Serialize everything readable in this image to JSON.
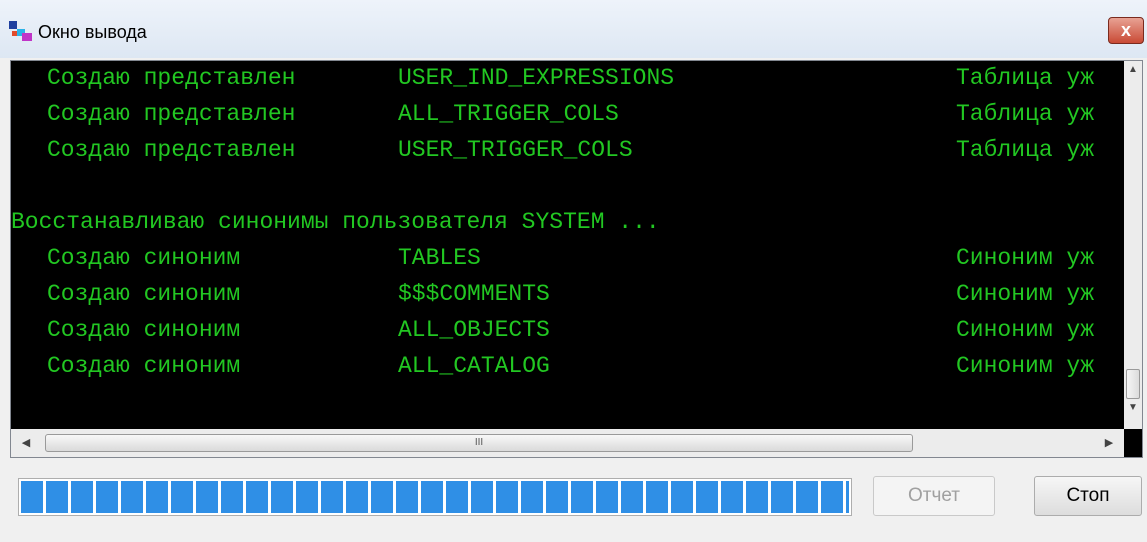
{
  "window": {
    "title": "Окно вывода",
    "close_label": "x"
  },
  "console": {
    "text_color": "#22c722",
    "background": "#000000",
    "lines": [
      {
        "indent": "  ",
        "action": "Создаю представлен",
        "object": "USER_IND_EXPRESSIONS",
        "status": "Таблица уж"
      },
      {
        "indent": "  ",
        "action": "Создаю представлен",
        "object": "ALL_TRIGGER_COLS",
        "status": "Таблица уж"
      },
      {
        "indent": "  ",
        "action": "Создаю представлен",
        "object": "USER_TRIGGER_COLS",
        "status": "Таблица уж"
      },
      {
        "indent": "",
        "action": "Восстанавливаю синонимы пользователя SYSTEM ...",
        "object": "",
        "status": ""
      },
      {
        "indent": "  ",
        "action": "Создаю синоним",
        "object": "TABLES",
        "status": "Синоним уж"
      },
      {
        "indent": "  ",
        "action": "Создаю синоним",
        "object": "$$$COMMENTS",
        "status": "Синоним уж"
      },
      {
        "indent": "  ",
        "action": "Создаю синоним",
        "object": "ALL_OBJECTS",
        "status": "Синоним уж"
      },
      {
        "indent": "  ",
        "action": "Создаю синоним",
        "object": "ALL_CATALOG",
        "status": "Синоним уж"
      }
    ]
  },
  "scrollbars": {
    "up_arrow": "▲",
    "down_arrow": "▼",
    "left_arrow": "◀",
    "right_arrow": "▶",
    "grip": "III"
  },
  "progress": {
    "fraction": 1.0,
    "color": "#2f8fe6"
  },
  "buttons": {
    "report_label": "Отчет",
    "stop_label": "Стоп"
  }
}
